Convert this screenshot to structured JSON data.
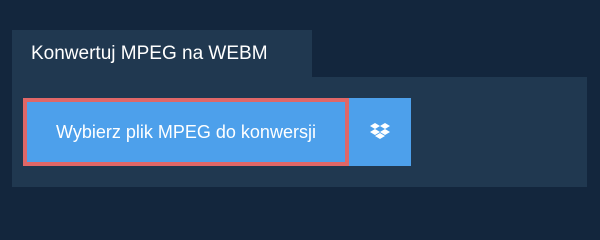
{
  "tab": {
    "title": "Konwertuj MPEG na WEBM"
  },
  "actions": {
    "select_file_label": "Wybierz plik MPEG do konwersji",
    "dropbox_icon": "dropbox-icon"
  },
  "colors": {
    "background": "#13263d",
    "panel": "#203850",
    "button": "#4da0eb",
    "button_focus_border": "#e06767",
    "text": "#ffffff"
  }
}
